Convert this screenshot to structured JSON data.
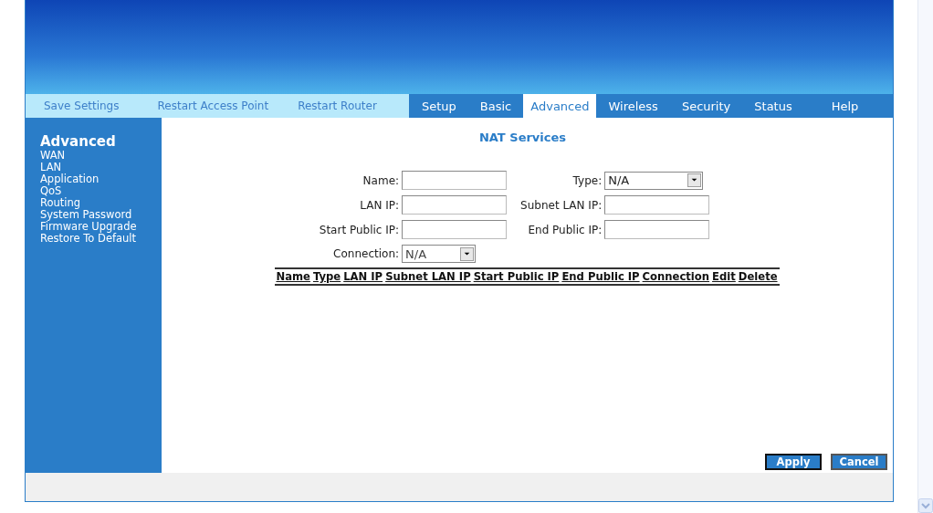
{
  "header_links": [
    "Save Settings",
    "Restart Access Point",
    "Restart Router"
  ],
  "tabs": [
    {
      "label": "Setup",
      "selected": false
    },
    {
      "label": "Basic",
      "selected": false
    },
    {
      "label": "Advanced",
      "selected": true
    },
    {
      "label": "Wireless",
      "selected": false
    },
    {
      "label": "Security",
      "selected": false
    },
    {
      "label": "Status",
      "selected": false
    },
    {
      "label": "Help",
      "selected": false
    }
  ],
  "sidebar": {
    "title": "Advanced",
    "items": [
      "WAN",
      "LAN",
      "Application",
      "QoS",
      "Routing",
      "System Password",
      "Firmware Upgrade",
      "Restore To Default"
    ]
  },
  "page_title": "NAT Services",
  "form": {
    "fields": [
      {
        "label": "Name:",
        "kind": "text"
      },
      {
        "label": "Type:",
        "kind": "select",
        "value": "N/A"
      },
      {
        "label": "LAN IP:",
        "kind": "text"
      },
      {
        "label": "Subnet LAN IP:",
        "kind": "text"
      },
      {
        "label": "Start Public IP:",
        "kind": "text"
      },
      {
        "label": "End Public IP:",
        "kind": "text"
      },
      {
        "label": "Connection:",
        "kind": "select",
        "value": "N/A"
      }
    ]
  },
  "table": {
    "columns": [
      "Name",
      "Type",
      "LAN IP",
      "Subnet LAN IP",
      "Start Public IP",
      "End Public IP",
      "Connection",
      "Edit",
      "Delete"
    ]
  },
  "buttons": [
    {
      "label": "Apply",
      "focused": true
    },
    {
      "label": "Cancel",
      "focused": false
    }
  ]
}
